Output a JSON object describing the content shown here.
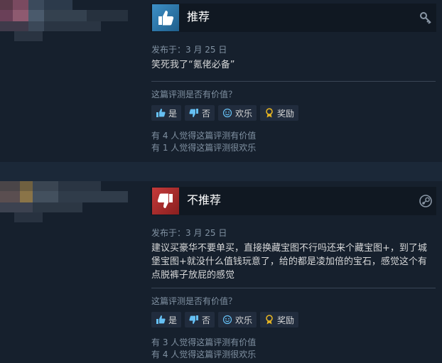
{
  "reviews": [
    {
      "verdict": "推荐",
      "posted": "发布于：3 月 25 日",
      "body": "笑死我了“氪佬必备”",
      "helpful_question": "这篇评测是否有价值？",
      "buttons": {
        "yes": "是",
        "no": "否",
        "funny": "欢乐",
        "award": "奖励"
      },
      "helpful_count": "有 4 人觉得这篇评测有价值",
      "funny_count": "有 1 人觉得这篇评测很欢乐",
      "icons": {
        "verdict": "thumbs-up-icon",
        "corner": "key-icon"
      }
    },
    {
      "verdict": "不推荐",
      "posted": "发布于：3 月 25 日",
      "body": "建议买豪华不要单买，直接换藏宝图不行吗还来个藏宝图+，到了城堡宝图+就没什么值钱玩意了，给的都是凌加倍的宝石，感觉这个有点脱裤子放屁的感觉",
      "helpful_question": "这篇评测是否有价值？",
      "buttons": {
        "yes": "是",
        "no": "否",
        "funny": "欢乐",
        "award": "奖励"
      },
      "helpful_count": "有 3 人觉得这篇评测有价值",
      "funny_count": "有 4 人觉得这篇评测很欢乐",
      "icons": {
        "verdict": "thumbs-down-icon",
        "corner": "steam-icon"
      }
    }
  ],
  "colors": {
    "page_bg": "#1b2838",
    "review_bg": "#16202d",
    "recommend_blue": "#3d8fc6",
    "not_recommend_red": "#c43a3a",
    "award_gold": "#e6b422"
  }
}
